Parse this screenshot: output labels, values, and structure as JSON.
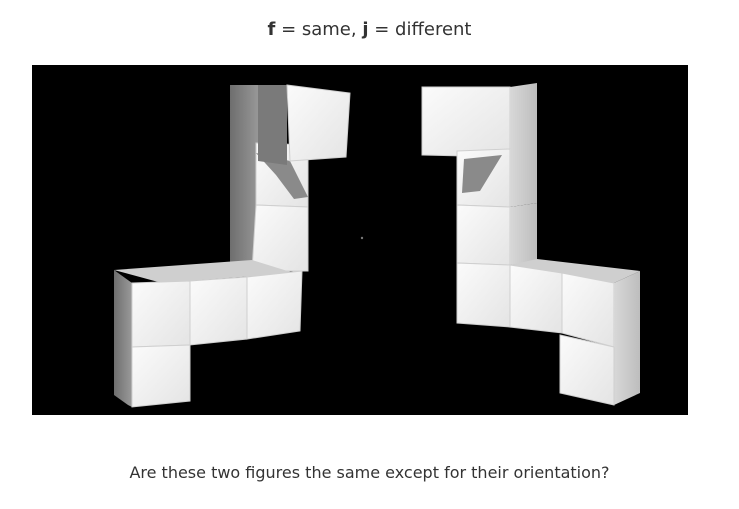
{
  "instructions": {
    "f_key": "f",
    "f_text": " = same, ",
    "j_key": "j",
    "j_text": " = different"
  },
  "stimulus": {
    "background_color": "#000000",
    "cube_face_color": "#f2f2f2"
  },
  "question": "Are these two figures the same except for their orientation?"
}
